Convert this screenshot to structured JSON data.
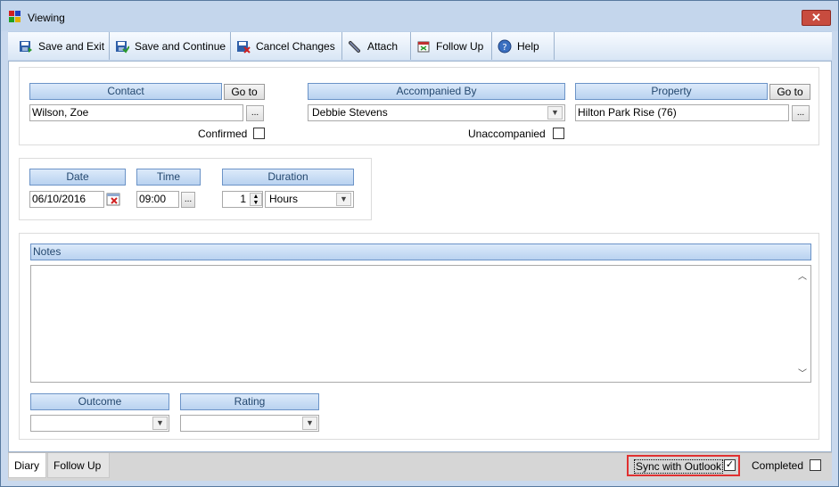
{
  "window": {
    "title": "Viewing",
    "close_label": "✕"
  },
  "toolbar": {
    "items": [
      {
        "label": "Save and Exit",
        "icon": "save-exit-icon"
      },
      {
        "label": "Save and Continue",
        "icon": "save-continue-icon"
      },
      {
        "label": "Cancel Changes",
        "icon": "cancel-changes-icon"
      },
      {
        "label": "Attach",
        "icon": "attach-icon"
      },
      {
        "label": "Follow Up",
        "icon": "follow-up-icon"
      },
      {
        "label": "Help",
        "icon": "help-icon"
      }
    ]
  },
  "contact": {
    "header": "Contact",
    "goto_label": "Go to",
    "value": "Wilson, Zoe",
    "ellipsis": "...",
    "confirmed_label": "Confirmed",
    "confirmed_checked": false
  },
  "accompanied": {
    "header": "Accompanied By",
    "value": "Debbie Stevens",
    "unaccompanied_label": "Unaccompanied",
    "unaccompanied_checked": false
  },
  "property": {
    "header": "Property",
    "goto_label": "Go to",
    "value": "Hilton Park Rise (76)",
    "ellipsis": "..."
  },
  "schedule": {
    "date_header": "Date",
    "date_value": "06/10/2016",
    "time_header": "Time",
    "time_value": "09:00",
    "time_ellipsis": "...",
    "duration_header": "Duration",
    "duration_value": "1",
    "duration_unit": "Hours"
  },
  "notes": {
    "header": "Notes",
    "value": ""
  },
  "outcome": {
    "header": "Outcome",
    "value": ""
  },
  "rating": {
    "header": "Rating",
    "value": ""
  },
  "tabs": [
    {
      "label": "Diary",
      "active": true
    },
    {
      "label": "Follow Up",
      "active": false
    }
  ],
  "footer": {
    "sync_label": "Sync with Outlook",
    "sync_checked": true,
    "completed_label": "Completed",
    "completed_checked": false,
    "highlight_color": "#e03030"
  },
  "colors": {
    "header_text": "#24486f",
    "header_border": "#6b93c7"
  }
}
